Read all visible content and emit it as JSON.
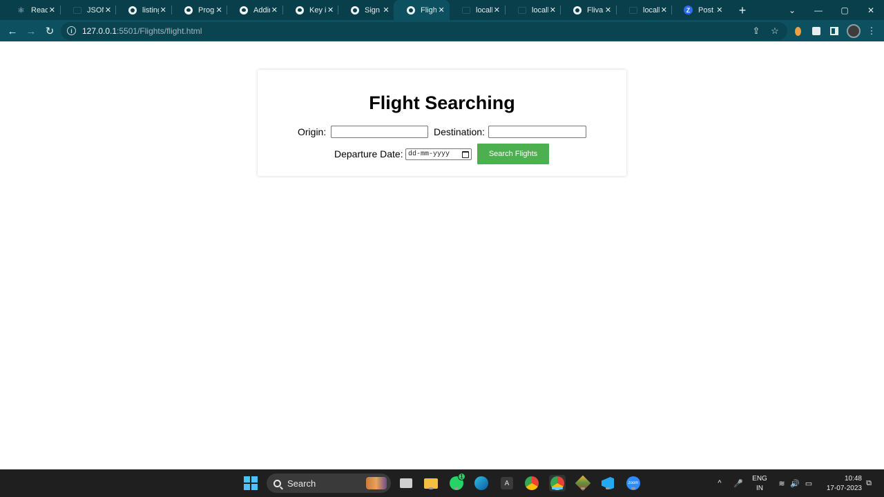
{
  "browser": {
    "tabs": [
      {
        "title": "React",
        "icon": "gear-icon"
      },
      {
        "title": "JSON",
        "icon": "blank-icon"
      },
      {
        "title": "listing",
        "icon": "globe-icon"
      },
      {
        "title": "Progr",
        "icon": "github-icon"
      },
      {
        "title": "Addin",
        "icon": "github-icon"
      },
      {
        "title": "Key is",
        "icon": "github-icon"
      },
      {
        "title": "Sign U",
        "icon": "globe-icon"
      },
      {
        "title": "Flight",
        "icon": "globe-icon",
        "active": true
      },
      {
        "title": "localh",
        "icon": "blank-icon"
      },
      {
        "title": "localh",
        "icon": "blank-icon"
      },
      {
        "title": "Flivan",
        "icon": "globe-icon"
      },
      {
        "title": "localh",
        "icon": "blank-icon"
      },
      {
        "title": "Post A",
        "icon": "zoom-z-icon"
      }
    ],
    "tab_close_glyph": "✕",
    "new_tab_glyph": "+",
    "url_host": "127.0.0.1",
    "url_rest": ":5501/Flights/flight.html",
    "info_glyph": "i",
    "icons": {
      "back": "←",
      "forward": "→",
      "reload": "↻",
      "share": "⇪",
      "star": "☆",
      "menu": "⋮",
      "tab_search": "⌄",
      "minimize": "—",
      "maximize": "▢",
      "close": "✕"
    }
  },
  "page": {
    "title": "Flight Searching",
    "origin_label": "Origin:",
    "origin_value": "",
    "destination_label": "Destination:",
    "destination_value": "",
    "departure_label": "Departure Date:",
    "date_placeholder": "dd-mm-yyyy",
    "search_button": "Search Flights",
    "button_color": "#4caf50"
  },
  "taskbar": {
    "search_label": "Search",
    "lang_top": "ENG",
    "lang_bottom": "IN",
    "time": "10:48",
    "date": "17-07-2023",
    "whatsapp_badge": "1",
    "app_a_label": "A",
    "zoom_label": "zoom",
    "chevron": "^",
    "mic": "🎤",
    "wifi": "≋",
    "volume": "🔊",
    "battery": "▭",
    "notify": "⧉"
  }
}
